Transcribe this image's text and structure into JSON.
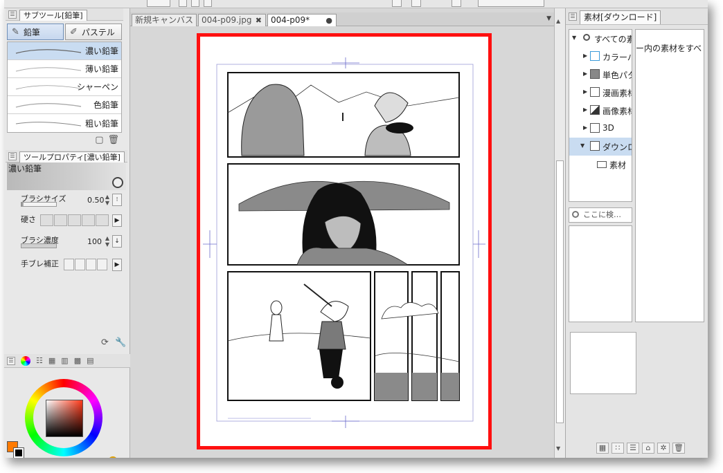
{
  "subtool": {
    "title": "サブツール[鉛筆]",
    "tabs": [
      {
        "label": "鉛筆",
        "icon": "pencil-icon"
      },
      {
        "label": "パステル",
        "icon": "pastel-icon"
      }
    ],
    "brushes": [
      "濃い鉛筆",
      "薄い鉛筆",
      "シャーペン",
      "色鉛筆",
      "粗い鉛筆"
    ],
    "selected_brush": "濃い鉛筆"
  },
  "tool_property": {
    "title": "ツールプロパティ[濃い鉛筆]",
    "preview_label": "濃い鉛筆",
    "brush_size_label": "ブラシサイズ",
    "brush_size_value": "0.50",
    "hardness_label": "硬さ",
    "density_label": "ブラシ濃度",
    "density_value": "100",
    "stabilization_label": "手ブレ補正"
  },
  "color": {
    "main_color": "#ff7a00",
    "sub_color": "#000000"
  },
  "canvas": {
    "tabs": [
      {
        "label": "新規キャンバス",
        "active": false
      },
      {
        "label": "004-p09.jpg",
        "active": false,
        "close": "✖"
      },
      {
        "label": "004-p09*",
        "active": true,
        "close": "●"
      }
    ],
    "highlight_color": "#ff1010"
  },
  "materials": {
    "title": "素材[ダウンロード]",
    "tree": [
      {
        "label": "すべての素材",
        "icon": "all-materials-icon",
        "expanded": true
      },
      {
        "label": "カラーパターン",
        "icon": "color-pattern-icon"
      },
      {
        "label": "単色パターン",
        "icon": "mono-pattern-icon"
      },
      {
        "label": "漫画素材",
        "icon": "manga-material-icon"
      },
      {
        "label": "画像素材",
        "icon": "image-material-icon"
      },
      {
        "label": "3D",
        "icon": "3d-icon"
      },
      {
        "label": "ダウンロード",
        "icon": "download-icon",
        "expanded": true,
        "selected": true
      },
      {
        "label": "素材",
        "icon": "folder-icon"
      }
    ],
    "view_message": "ー内の素材をすべ",
    "search_placeholder": "ここに検…"
  }
}
